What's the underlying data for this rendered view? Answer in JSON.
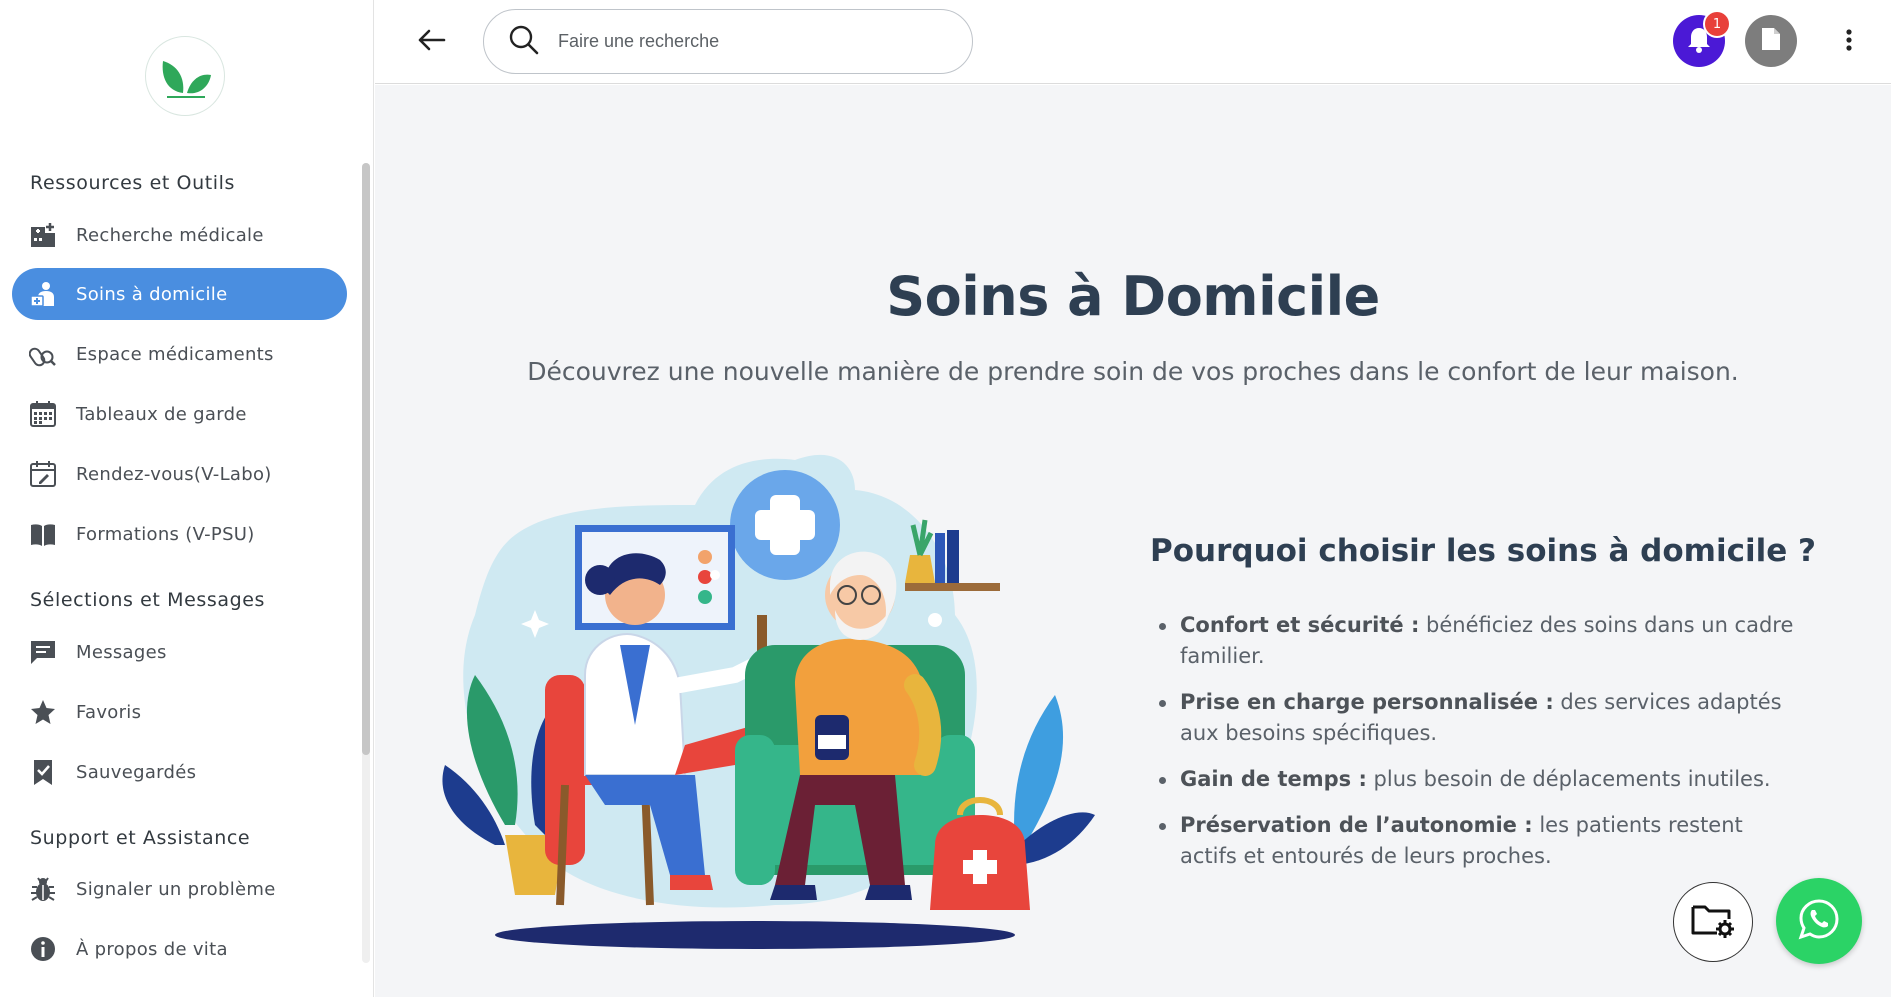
{
  "sidebar": {
    "sections": [
      {
        "title": "Ressources et Outils",
        "items": [
          {
            "label": "Recherche médicale",
            "icon": "hospital-icon"
          },
          {
            "label": "Soins à domicile",
            "icon": "home-care-icon",
            "active": true
          },
          {
            "label": "Espace médicaments",
            "icon": "medication-search-icon"
          },
          {
            "label": "Tableaux de garde",
            "icon": "calendar-grid-icon"
          },
          {
            "label": "Rendez-vous(V-Labo)",
            "icon": "calendar-edit-icon"
          },
          {
            "label": "Formations (V-PSU)",
            "icon": "book-icon"
          }
        ]
      },
      {
        "title": "Sélections et Messages",
        "items": [
          {
            "label": "Messages",
            "icon": "message-icon"
          },
          {
            "label": "Favoris",
            "icon": "star-icon"
          },
          {
            "label": "Sauvegardés",
            "icon": "bookmark-check-icon"
          }
        ]
      },
      {
        "title": "Support et Assistance",
        "items": [
          {
            "label": "Signaler un problème",
            "icon": "bug-icon"
          },
          {
            "label": "À propos de vita",
            "icon": "info-icon"
          }
        ]
      }
    ]
  },
  "topbar": {
    "search_placeholder": "Faire une recherche",
    "notification_count": "1"
  },
  "main": {
    "title": "Soins à Domicile",
    "subtitle": "Découvrez une nouvelle manière de prendre soin de vos proches dans le confort de leur maison.",
    "why_title": "Pourquoi choisir les soins à domicile ?",
    "benefits": [
      {
        "bold": "Confort et sécurité :",
        "text": " bénéficiez des soins dans un cadre familier."
      },
      {
        "bold": "Prise en charge personnalisée :",
        "text": " des services adaptés aux besoins spécifiques."
      },
      {
        "bold": "Gain de temps :",
        "text": " plus besoin de déplacements inutiles."
      },
      {
        "bold": "Préservation de l’autonomie :",
        "text": " les patients restent actifs et entourés de leurs proches."
      }
    ]
  },
  "colors": {
    "accent": "#4a8ee0",
    "notification": "#4b19d6",
    "badge": "#e8403a",
    "whatsapp": "#2bd366",
    "logo_green": "#2fa85a"
  }
}
